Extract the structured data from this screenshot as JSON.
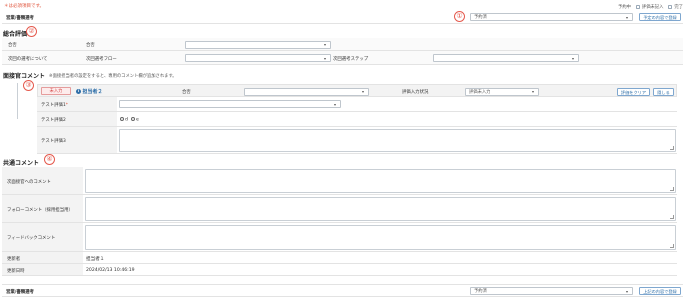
{
  "required_note": "＊は必須項目です。",
  "legend": [
    {
      "label": "予約中",
      "checkbox": false
    },
    {
      "label": "評価未記入",
      "checkbox": true
    },
    {
      "label": "完了",
      "checkbox": true
    }
  ],
  "top_bar": {
    "label": "営業/書類選考",
    "select_value": "予約済",
    "button_label": "予定の内容で登録",
    "callout": "①"
  },
  "overall": {
    "title": "総合評価",
    "callout": "②",
    "rows": [
      {
        "label": "合否",
        "field_label": "合否",
        "select_value": ""
      },
      {
        "label": "次回の選考について",
        "field_label": "次回選考フロー",
        "select_value": "",
        "field2_label": "次回選考ステップ",
        "select2_value": ""
      }
    ]
  },
  "interviewer": {
    "title": "面接官コメント",
    "note": "※面接担当者の設定をすると、専用のコメント欄が追加されます。",
    "callout": "③",
    "status_badge": "未入力",
    "person_icon_text": "i",
    "person_name": "担当者２",
    "pass_label": "合否",
    "pass_value": "",
    "eval_status_label": "評価入力状況",
    "eval_status_value": "評価未入力",
    "clear_button": "評価をクリア",
    "hide_button": "隠しる",
    "eval1_label": "テスト評価1",
    "eval1_required": "*",
    "eval1_value": "",
    "eval2_label": "テスト評価2",
    "eval2_options": [
      "d",
      "e"
    ],
    "eval3_label": "テスト評価3"
  },
  "common": {
    "title": "共通コメント",
    "callout": "④",
    "fields": [
      {
        "label": "次面接官へのコメント"
      },
      {
        "label": "フォローコメント（採用担当用）"
      },
      {
        "label": "フィードバックコメント"
      }
    ],
    "updated_by_label": "更新者",
    "updated_by_value": "担当者１",
    "updated_at_label": "更新日時",
    "updated_at_value": "2024/02/13 10:46:19"
  },
  "bottom_bar": {
    "label": "営業/書類選考",
    "select_value": "予約済",
    "button_label": "上記の内容で登録"
  }
}
